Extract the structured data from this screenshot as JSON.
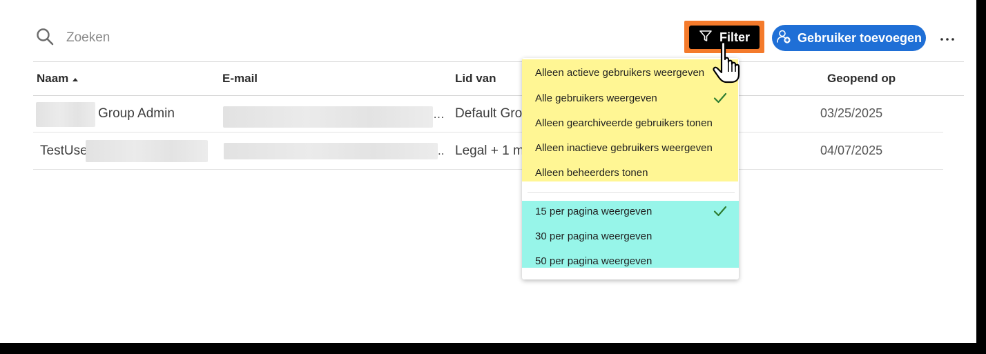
{
  "search": {
    "placeholder": "Zoeken"
  },
  "toolbar": {
    "filter_label": "Filter",
    "add_user_label": "Gebruiker toevoegen",
    "more_label": "…"
  },
  "table": {
    "columns": [
      "Naam",
      "E-mail",
      "Lid van",
      "Geopend op"
    ],
    "rows": [
      {
        "name_suffix": "Group Admin",
        "email_suffix": "…",
        "member_of": "Default Gro",
        "opened_on": "03/25/2025"
      },
      {
        "name_prefix": "TestUse",
        "email_suffix": "..",
        "member_of": "Legal + 1 m",
        "opened_on": "04/07/2025"
      }
    ]
  },
  "filter_menu": {
    "user_filters": [
      {
        "label": "Alleen actieve gebruikers weergeven",
        "checked": false
      },
      {
        "label": "Alle gebruikers weergeven",
        "checked": true
      },
      {
        "label": "Alleen gearchiveerde gebruikers tonen",
        "checked": false
      },
      {
        "label": "Alleen inactieve gebruikers weergeven",
        "checked": false
      },
      {
        "label": "Alleen beheerders tonen",
        "checked": false
      }
    ],
    "page_sizes": [
      {
        "label": "15 per pagina weergeven",
        "checked": true
      },
      {
        "label": "30 per pagina weergeven",
        "checked": false
      },
      {
        "label": "50 per pagina weergeven",
        "checked": false
      }
    ]
  },
  "colors": {
    "primary": "#1f6fd6",
    "filter_highlight": "#f47a2b",
    "menu_highlight_yellow": "#fff694",
    "menu_highlight_cyan": "#97f5e9",
    "checkmark": "#2e7d32"
  }
}
